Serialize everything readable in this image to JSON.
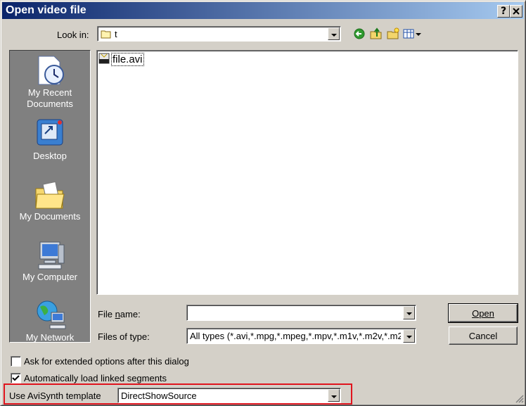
{
  "window": {
    "title": "Open video file",
    "help_button": "?",
    "close_button": "✕"
  },
  "look_in": {
    "label": "Look in:",
    "value": "t"
  },
  "toolbar": {
    "icons": [
      "back-icon",
      "up-folder-icon",
      "new-folder-icon",
      "view-menu-icon"
    ]
  },
  "places": [
    {
      "label": "My Recent Documents",
      "icon": "recent-documents-icon"
    },
    {
      "label": "Desktop",
      "icon": "desktop-icon"
    },
    {
      "label": "My Documents",
      "icon": "my-documents-icon"
    },
    {
      "label": "My Computer",
      "icon": "my-computer-icon"
    },
    {
      "label": "My Network",
      "icon": "my-network-icon"
    }
  ],
  "files": [
    {
      "name": "file.avi",
      "icon": "avi-file-icon"
    }
  ],
  "file_name": {
    "label": "File name:",
    "value": ""
  },
  "files_of_type": {
    "label": "Files of type:",
    "value": "All types (*.avi,*.mpg,*.mpeg,*.mpv,*.m1v,*.m2v,*.m2"
  },
  "buttons": {
    "open": "Open",
    "cancel": "Cancel"
  },
  "options": {
    "extended": {
      "label": "Ask for extended options after this dialog",
      "checked": false
    },
    "linked": {
      "label": "Automatically load linked segments",
      "checked": true
    }
  },
  "avisynth": {
    "label": "Use AviSynth template",
    "value": "DirectShowSource"
  },
  "colors": {
    "title_start": "#0a246a",
    "title_end": "#a6caf0",
    "highlight_box": "#e0141e",
    "face": "#d4d0c8"
  }
}
